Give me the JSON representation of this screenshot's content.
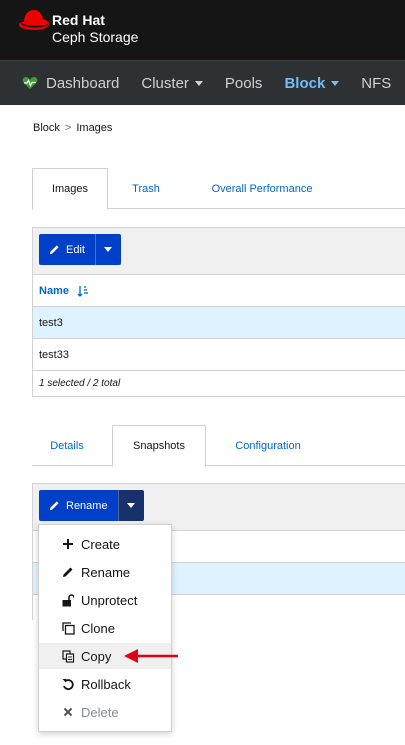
{
  "brand": {
    "line1": "Red Hat",
    "line2": "Ceph Storage"
  },
  "nav": {
    "items": [
      {
        "label": "Dashboard",
        "has_caret": false
      },
      {
        "label": "Cluster",
        "has_caret": true
      },
      {
        "label": "Pools",
        "has_caret": false
      },
      {
        "label": "Block",
        "has_caret": true,
        "active": true
      },
      {
        "label": "NFS",
        "has_caret": false
      }
    ]
  },
  "breadcrumb": {
    "root": "Block",
    "separator": ">",
    "current": "Images"
  },
  "image_tabs": [
    {
      "label": "Images",
      "active": true
    },
    {
      "label": "Trash",
      "active": false
    },
    {
      "label": "Overall Performance",
      "active": false
    }
  ],
  "images_panel": {
    "edit_label": "Edit",
    "column_name": "Name",
    "rows": [
      "test3",
      "test33"
    ],
    "footer": "1 selected / 2 total"
  },
  "detail_tabs": [
    {
      "label": "Details",
      "active": false
    },
    {
      "label": "Snapshots",
      "active": true
    },
    {
      "label": "Configuration",
      "active": false
    }
  ],
  "snapshots_panel": {
    "rename_label": "Rename"
  },
  "dropdown": {
    "items": [
      {
        "label": "Create",
        "icon": "plus-icon"
      },
      {
        "label": "Rename",
        "icon": "pencil-icon"
      },
      {
        "label": "Unprotect",
        "icon": "unlock-icon"
      },
      {
        "label": "Clone",
        "icon": "clone-icon"
      },
      {
        "label": "Copy",
        "icon": "copy-icon",
        "hovered": true
      },
      {
        "label": "Rollback",
        "icon": "rollback-icon"
      },
      {
        "label": "Delete",
        "icon": "times-icon",
        "disabled": true
      }
    ]
  },
  "colors": {
    "primary": "#0040c8",
    "link": "#0066cc",
    "nav_active": "#73bcf7",
    "selected_row": "#def3ff",
    "annotation_arrow": "#e0001a"
  }
}
